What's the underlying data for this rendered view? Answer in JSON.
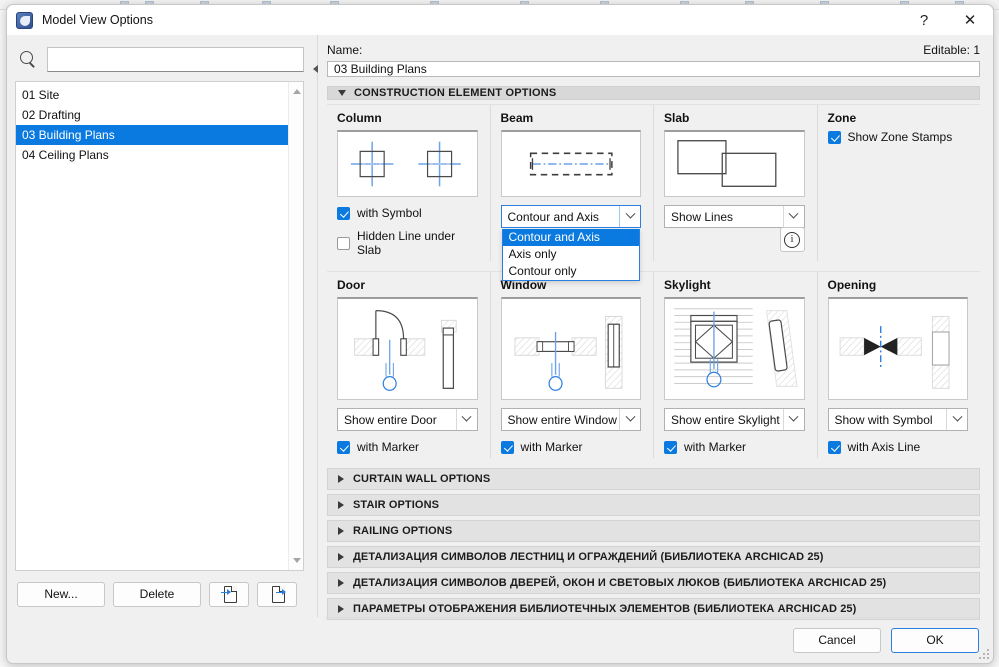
{
  "window": {
    "title": "Model View Options",
    "help_label": "?",
    "close_label": "✕"
  },
  "left": {
    "search_placeholder": "",
    "search_value": "",
    "items": [
      {
        "label": "01 Site",
        "selected": false
      },
      {
        "label": "02 Drafting",
        "selected": false
      },
      {
        "label": "03 Building Plans",
        "selected": true
      },
      {
        "label": "04 Ceiling Plans",
        "selected": false
      }
    ],
    "new_label": "New...",
    "delete_label": "Delete",
    "import_icon": "import-document-icon",
    "export_icon": "export-document-icon"
  },
  "right": {
    "name_label": "Name:",
    "editable_label": "Editable: 1",
    "name_value": "03 Building Plans",
    "section_title": "CONSTRUCTION ELEMENT OPTIONS",
    "column": {
      "title": "Column",
      "checkbox_with_symbol": "with Symbol",
      "with_symbol_checked": true,
      "checkbox_hidden_line": "Hidden Line under Slab",
      "hidden_line_checked": false
    },
    "beam": {
      "title": "Beam",
      "combo_value": "Contour and Axis",
      "combo_open": true,
      "options": [
        {
          "label": "Contour and Axis",
          "highlighted": true
        },
        {
          "label": "Axis only",
          "highlighted": false
        },
        {
          "label": "Contour only",
          "highlighted": false
        }
      ]
    },
    "slab": {
      "title": "Slab",
      "combo_value": "Show Lines",
      "info_icon": "info-icon"
    },
    "zone": {
      "title": "Zone",
      "checkbox_label": "Show Zone Stamps",
      "checked": true
    },
    "door": {
      "title": "Door",
      "combo_value": "Show entire Door",
      "checkbox_label": "with Marker",
      "checked": true
    },
    "window": {
      "title": "Window",
      "combo_value": "Show entire Window",
      "checkbox_label": "with Marker",
      "checked": true
    },
    "skylight": {
      "title": "Skylight",
      "combo_value": "Show entire Skylight",
      "checkbox_label": "with Marker",
      "checked": true
    },
    "opening": {
      "title": "Opening",
      "combo_value": "Show with Symbol",
      "checkbox_label": "with Axis Line",
      "checked": true
    },
    "collapsed_sections": [
      "CURTAIN WALL OPTIONS",
      "STAIR OPTIONS",
      "RAILING OPTIONS",
      "ДЕТАЛИЗАЦИЯ СИМВОЛОВ ЛЕСТНИЦ И ОГРАЖДЕНИЙ (БИБЛИОТЕКА ARCHICAD 25)",
      "ДЕТАЛИЗАЦИЯ СИМВОЛОВ ДВЕРЕЙ, ОКОН И СВЕТОВЫХ ЛЮКОВ (БИБЛИОТЕКА ARCHICAD 25)",
      "ПАРАМЕТРЫ ОТОБРАЖЕНИЯ БИБЛИОТЕЧНЫХ ЭЛЕМЕНТОВ (БИБЛИОТЕКА ARCHICAD 25)"
    ]
  },
  "footer": {
    "cancel_label": "Cancel",
    "ok_label": "OK"
  },
  "colors": {
    "accent": "#0a7ae0",
    "selection": "#0a7ae0",
    "header_bg": "#d8d8d8",
    "collapsed_bg": "#e2e2e2",
    "drawing_blue": "#6ba3e8"
  }
}
